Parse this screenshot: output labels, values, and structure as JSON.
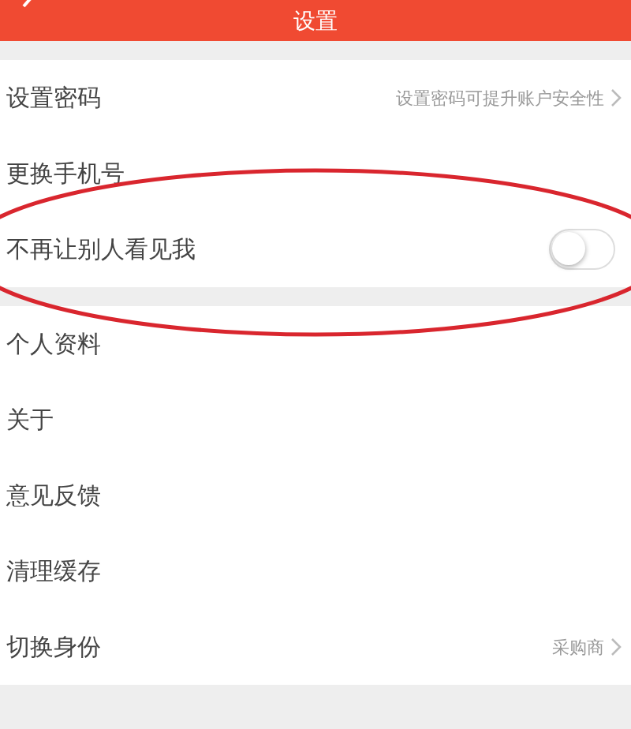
{
  "header": {
    "title": "设置"
  },
  "groups": [
    {
      "items": [
        {
          "kind": "link",
          "label": "设置密码",
          "value": "设置密码可提升账户安全性"
        },
        {
          "kind": "plain",
          "label": "更换手机号"
        },
        {
          "kind": "toggle",
          "label": "不再让别人看见我",
          "on": false
        }
      ]
    },
    {
      "items": [
        {
          "kind": "plain",
          "label": "个人资料"
        },
        {
          "kind": "plain",
          "label": "关于"
        },
        {
          "kind": "plain",
          "label": "意见反馈"
        },
        {
          "kind": "plain",
          "label": "清理缓存"
        },
        {
          "kind": "link",
          "label": "切换身份",
          "value": "采购商"
        }
      ]
    }
  ],
  "annotation": {
    "kind": "ellipse",
    "color": "#d9262e"
  }
}
